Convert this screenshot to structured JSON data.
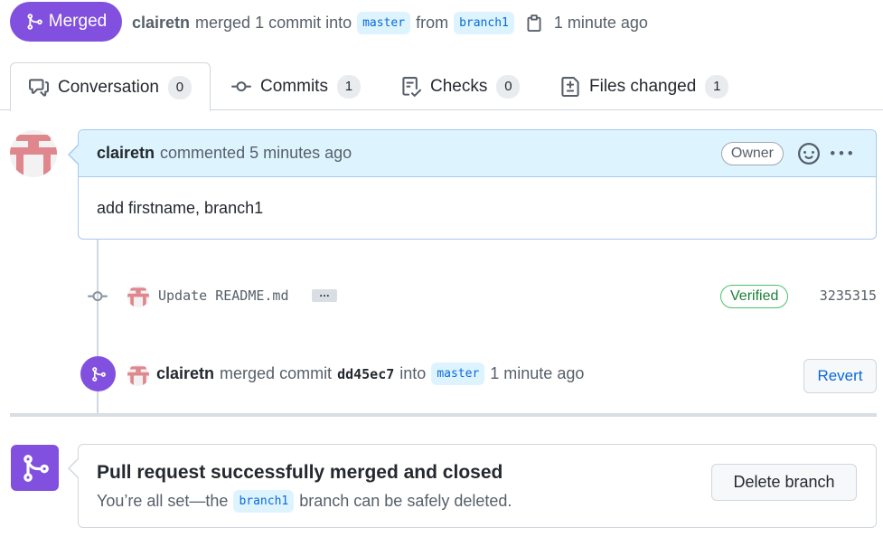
{
  "header": {
    "state_label": "Merged",
    "author": "clairetn",
    "merged_text": "merged 1 commit into",
    "base_branch": "master",
    "from_text": "from",
    "head_branch": "branch1",
    "time": "1 minute ago"
  },
  "tabs": [
    {
      "label": "Conversation",
      "count": "0",
      "icon": "comment-discussion-icon"
    },
    {
      "label": "Commits",
      "count": "1",
      "icon": "git-commit-icon"
    },
    {
      "label": "Checks",
      "count": "0",
      "icon": "checklist-icon"
    },
    {
      "label": "Files changed",
      "count": "1",
      "icon": "file-diff-icon"
    }
  ],
  "comment": {
    "author": "clairetn",
    "action": "commented 5 minutes ago",
    "role": "Owner",
    "body": "add firstname, branch1"
  },
  "commit": {
    "message": "Update README.md",
    "ellipsis": "…",
    "verified": "Verified",
    "sha": "3235315"
  },
  "merge_event": {
    "author": "clairetn",
    "text1": "merged commit",
    "sha": "dd45ec7",
    "text2": "into",
    "branch": "master",
    "time": "1 minute ago",
    "revert_label": "Revert"
  },
  "merged_box": {
    "title": "Pull request successfully merged and closed",
    "sub_before": "You’re all set—the",
    "branch": "branch1",
    "sub_after": "branch can be safely deleted.",
    "delete_label": "Delete branch"
  },
  "colors": {
    "merged_purple": "#8250df",
    "link_blue": "#0969da",
    "verified_green": "#1a7f37"
  }
}
